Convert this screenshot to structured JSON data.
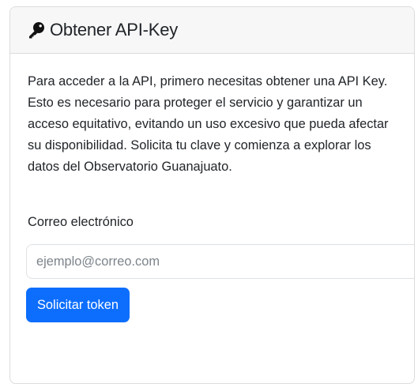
{
  "card": {
    "icon": "key-icon",
    "title": "Obtener API-Key",
    "description": "Para acceder a la API, primero necesitas obtener una API Key. Esto es necesario para proteger el servicio y garantizar un acceso equitativo, evitando un uso excesivo que pueda afectar su disponibilidad. Solicita tu clave y comienza a explorar los datos del Observatorio Guanajuato."
  },
  "form": {
    "email_label": "Correo electrónico",
    "email_placeholder": "ejemplo@correo.com",
    "email_value": "",
    "submit_label": "Solicitar token"
  },
  "colors": {
    "primary": "#0d6efd",
    "header_bg": "#f7f7f7",
    "border": "#dcdcdc",
    "text": "#212529",
    "placeholder": "#7d848b"
  }
}
